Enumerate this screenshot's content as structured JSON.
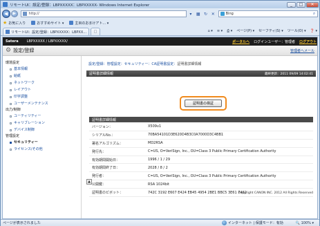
{
  "browser": {
    "title": "リモートUI：設定/登録：LBPXXXXX：LBPXXXXX- Windows Internet Explorer",
    "minimize": "_",
    "maximize": "□",
    "close": "✕",
    "back_icon": "◀",
    "forward_icon": "▶",
    "address": "http://",
    "search_text": "Bing",
    "fav_label": "お気に入り",
    "fav_sites": "おすすめサイト ▾",
    "fav_news": "主目のおまけアト... ▾",
    "tab_label": "リモートUI：設定/登録：LBPXXXXX：LBPXX...",
    "commands": [
      "ページ(P) ▾",
      "セーフティ(S) ▾",
      "ツール(O) ▾",
      "❓ ▾"
    ]
  },
  "header": {
    "brand": "Satera",
    "model": "LBPXXXXX / LBPXXXXX/",
    "portal": "ポータルへ",
    "login_user": "ログインユーザー：管理者",
    "logout": "ログアウト"
  },
  "subheader": {
    "title": "設定/登録",
    "manager_mail": "管理者へメール"
  },
  "sidebar": {
    "sections": [
      {
        "label": "環境設定",
        "items": [
          "基本情報",
          "給紙",
          "ネットワーク",
          "レイアウト",
          "印字調整",
          "ユーザーメンテナンス"
        ]
      },
      {
        "label": "出力/制御",
        "items": [
          "ユーティリティー",
          "キャリブレーション",
          "デバイス制御"
        ]
      },
      {
        "label": "管理設定",
        "items": [
          "セキュリティー",
          "ライセンス/その他"
        ]
      }
    ],
    "selected": "セキュリティー"
  },
  "breadcrumb": {
    "path": "設定/登録：管理設定：セキュリティー：CA証明書設定：",
    "current": "証明書詳細情報"
  },
  "page": {
    "section_title": "証明書詳細情報",
    "updated": "最終更新：2011 09/09 14:02:41",
    "verify_button": "証明書の検証",
    "details_title": "証明書詳細情報",
    "details": [
      {
        "k": "バージョン：",
        "v": "X509v1"
      },
      {
        "k": "シリアルNo.：",
        "v": "70BA54101D3E620D4B3C0A7000D3C4BB1"
      },
      {
        "k": "署名アルゴリズム：",
        "v": "MD2RSA"
      },
      {
        "k": "発行先：",
        "v": "C=US, O=VeriSign, Inc., OU=Class 3 Public Primary Certification Authority"
      },
      {
        "k": "有効期間開始日：",
        "v": "1996 / 1 / 29"
      },
      {
        "k": "有効期間終了日：",
        "v": "2028 / 8 / 2"
      },
      {
        "k": "発行者：",
        "v": "C=US, O=VeriSign, Inc., OU=Class 3 Public Primary Certification Authority"
      },
      {
        "k": "公開鍵：",
        "v": "RSA 1024bit"
      },
      {
        "k": "証明書のピボット：",
        "v": "742C 3192 E607 E424 EB45 4954 2BE1 BBC5 3E61 7462"
      }
    ],
    "top_icon": "▲",
    "copyright": "Copyright CANON INC. 2012 All Rights Reserved"
  },
  "status": {
    "left": "ページが表示されました",
    "zone": "インターネット | 保護モード：有効",
    "zoom": "🔍 100% ▾"
  }
}
